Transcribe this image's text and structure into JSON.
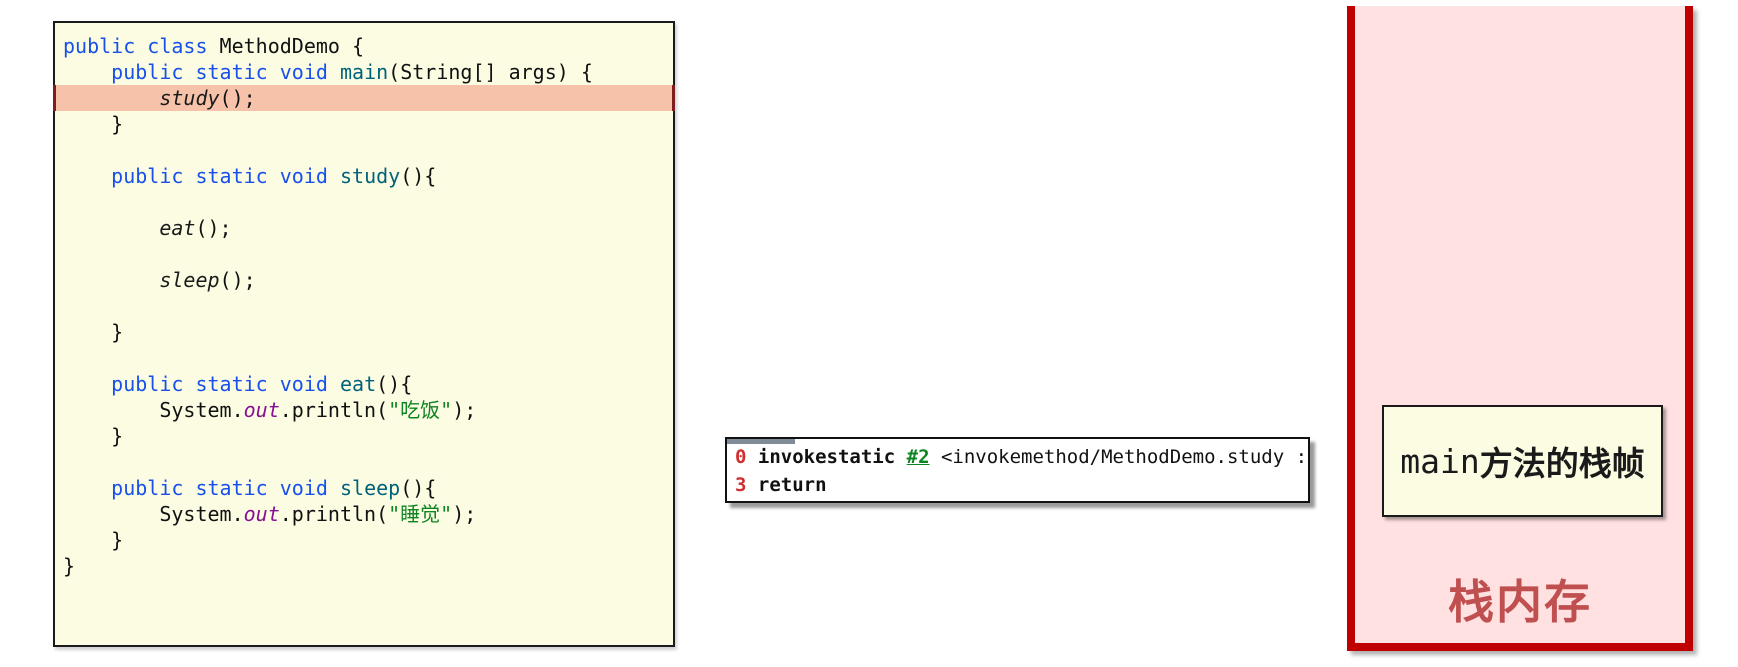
{
  "colors": {
    "code_bg": "#FCFCE3",
    "highlight_line": "#F6C3AA",
    "highlight_edge": "#7E1E1E",
    "keyword_blue": "#1750EB",
    "method_teal": "#00627A",
    "field_purple": "#871094",
    "string_green": "#0E8420",
    "bytecode_num_red": "#D12F2F",
    "stack_border_red": "#C00000",
    "stack_bg_pink": "#FFE1E1",
    "stack_title_red": "#C05050"
  },
  "code_panel": {
    "lines": [
      {
        "hl": false,
        "segs": [
          [
            "public",
            "k"
          ],
          [
            " ",
            "p"
          ],
          [
            "class",
            "k"
          ],
          [
            " MethodDemo {",
            "p"
          ]
        ]
      },
      {
        "hl": false,
        "segs": [
          [
            "    ",
            "p"
          ],
          [
            "public",
            "k"
          ],
          [
            " ",
            "p"
          ],
          [
            "static",
            "k"
          ],
          [
            " ",
            "p"
          ],
          [
            "void",
            "k"
          ],
          [
            " ",
            "p"
          ],
          [
            "main",
            "d"
          ],
          [
            "(String[] args) {",
            "p"
          ]
        ]
      },
      {
        "hl": true,
        "segs": [
          [
            "        ",
            "p"
          ],
          [
            "study",
            "c"
          ],
          [
            "();",
            "p"
          ]
        ]
      },
      {
        "hl": false,
        "segs": [
          [
            "    }",
            "p"
          ]
        ]
      },
      {
        "hl": false,
        "segs": []
      },
      {
        "hl": false,
        "segs": [
          [
            "    ",
            "p"
          ],
          [
            "public",
            "k"
          ],
          [
            " ",
            "p"
          ],
          [
            "static",
            "k"
          ],
          [
            " ",
            "p"
          ],
          [
            "void",
            "k"
          ],
          [
            " ",
            "p"
          ],
          [
            "study",
            "d"
          ],
          [
            "(){",
            "p"
          ]
        ]
      },
      {
        "hl": false,
        "segs": []
      },
      {
        "hl": false,
        "segs": [
          [
            "        ",
            "p"
          ],
          [
            "eat",
            "c"
          ],
          [
            "();",
            "p"
          ]
        ]
      },
      {
        "hl": false,
        "segs": []
      },
      {
        "hl": false,
        "segs": [
          [
            "        ",
            "p"
          ],
          [
            "sleep",
            "c"
          ],
          [
            "();",
            "p"
          ]
        ]
      },
      {
        "hl": false,
        "segs": []
      },
      {
        "hl": false,
        "segs": [
          [
            "    }",
            "p"
          ]
        ]
      },
      {
        "hl": false,
        "segs": []
      },
      {
        "hl": false,
        "segs": [
          [
            "    ",
            "p"
          ],
          [
            "public",
            "k"
          ],
          [
            " ",
            "p"
          ],
          [
            "static",
            "k"
          ],
          [
            " ",
            "p"
          ],
          [
            "void",
            "k"
          ],
          [
            " ",
            "p"
          ],
          [
            "eat",
            "d"
          ],
          [
            "(){",
            "p"
          ]
        ]
      },
      {
        "hl": false,
        "segs": [
          [
            "        System.",
            "p"
          ],
          [
            "out",
            "f"
          ],
          [
            ".println(",
            "p"
          ],
          [
            "\"吃饭\"",
            "s"
          ],
          [
            ");",
            "p"
          ]
        ]
      },
      {
        "hl": false,
        "segs": [
          [
            "    }",
            "p"
          ]
        ]
      },
      {
        "hl": false,
        "segs": []
      },
      {
        "hl": false,
        "segs": [
          [
            "    ",
            "p"
          ],
          [
            "public",
            "k"
          ],
          [
            " ",
            "p"
          ],
          [
            "static",
            "k"
          ],
          [
            " ",
            "p"
          ],
          [
            "void",
            "k"
          ],
          [
            " ",
            "p"
          ],
          [
            "sleep",
            "d"
          ],
          [
            "(){",
            "p"
          ]
        ]
      },
      {
        "hl": false,
        "segs": [
          [
            "        System.",
            "p"
          ],
          [
            "out",
            "f"
          ],
          [
            ".println(",
            "p"
          ],
          [
            "\"睡觉\"",
            "s"
          ],
          [
            ");",
            "p"
          ]
        ]
      },
      {
        "hl": false,
        "segs": [
          [
            "    }",
            "p"
          ]
        ]
      },
      {
        "hl": false,
        "segs": [
          [
            "}",
            "p"
          ]
        ]
      }
    ]
  },
  "bytecode_box": {
    "lines": [
      {
        "num": "0",
        "op": "invokestatic",
        "ref": "#2",
        "rest": " <invokemethod/MethodDemo.study :"
      },
      {
        "num": "3",
        "op": "return",
        "ref": "",
        "rest": ""
      }
    ]
  },
  "stack_panel": {
    "frame_label_latin": "main",
    "frame_label_cjk": "方法的栈帧",
    "title": "栈内存"
  }
}
